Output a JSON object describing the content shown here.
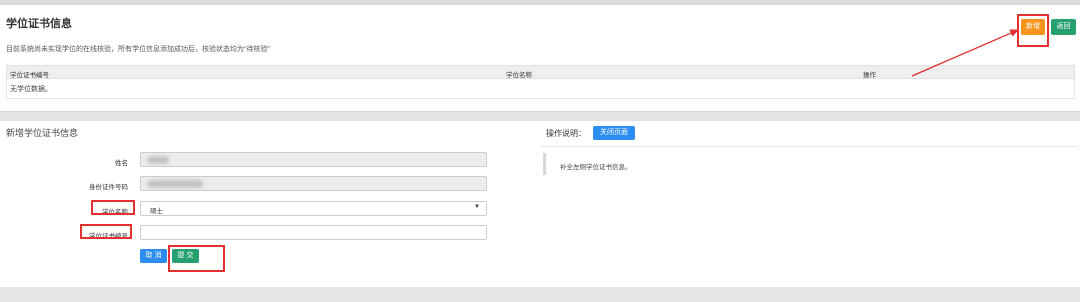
{
  "certificate_info": {
    "title": "学位证书信息",
    "note": "目前系统尚未实现学位的在线核验，所有学位信息添加成功后，核验状态均为“待核验”",
    "add_button": "新增",
    "return_button": "返回",
    "table": {
      "headers": [
        "学位证书编号",
        "学位名称",
        "操作"
      ],
      "empty_text": "无学位数据。"
    }
  },
  "new_certificate_form": {
    "title": "新增学位证书信息",
    "fields": {
      "name_label": "姓名",
      "id_number_label": "身份证件号码",
      "degree_name_label": "学位名称",
      "degree_name_value": "硕士",
      "certificate_number_label": "学位证书编号",
      "certificate_number_value": ""
    },
    "cancel_button": "取 消",
    "submit_button": "提 交"
  },
  "instructions": {
    "title": "操作说明：",
    "close_button": "关闭页面",
    "text": "补全左侧学位证书信息。"
  },
  "colors": {
    "add_button": "#f7941d",
    "return_button": "#26a06e",
    "cancel_button": "#2d8cf0",
    "submit_button": "#26a06e",
    "close_button": "#2d8cf0",
    "highlight": "#e53030"
  }
}
